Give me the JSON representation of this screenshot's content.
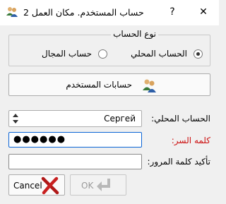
{
  "window": {
    "title": "حساب المستخدم. مكان العمل 2",
    "help_label": "?",
    "close_label": "✕",
    "app_icon": "user-account-icon"
  },
  "account_type": {
    "title": "نوع الحساب",
    "options": [
      {
        "label": "الحساب المحلي",
        "checked": true
      },
      {
        "label": "حساب المجال",
        "checked": false
      }
    ]
  },
  "accounts_button": {
    "label": "حسابات المستخدم",
    "icon": "users-icon"
  },
  "form": {
    "local_account_label": "الحساب المحلي:",
    "local_account_value": "Сергей",
    "password_label": "كلمه السر:",
    "password_value": "●●●●●●",
    "confirm_label": "تأكيد كلمة المرور:",
    "confirm_value": ""
  },
  "buttons": {
    "cancel_label": "Cancel",
    "ok_label": "OK"
  },
  "colors": {
    "password_label": "#cc1111",
    "focus_border": "#0a64d6",
    "disabled_text": "#9a9a9a"
  }
}
